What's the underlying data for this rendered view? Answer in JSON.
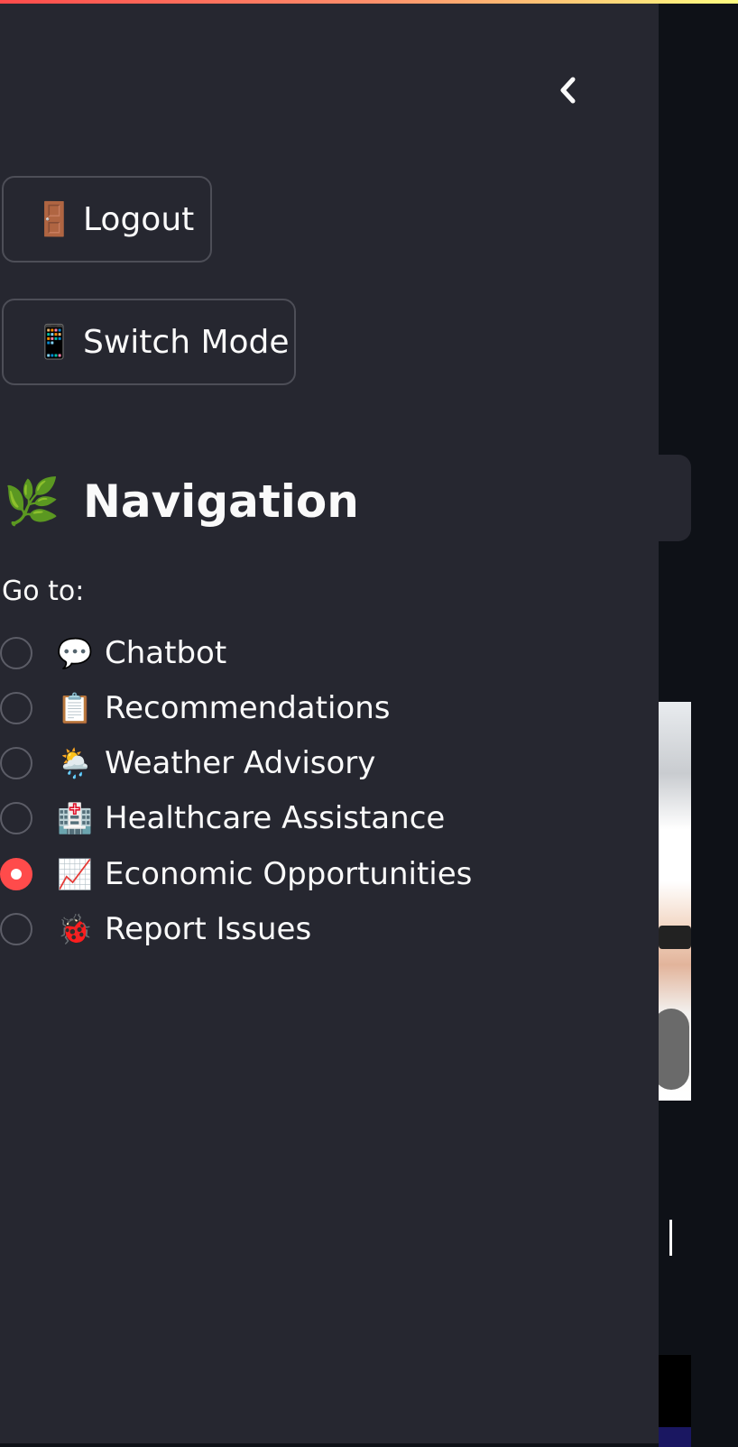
{
  "sidebar": {
    "collapse_icon": "chevron-left-icon",
    "buttons": {
      "logout": {
        "icon": "🚪",
        "label": "Logout"
      },
      "switch_mode": {
        "icon": "📱",
        "label": "Switch Mode"
      }
    },
    "navigation": {
      "heading_icon": "🌿",
      "heading": "Navigation",
      "goto_label": "Go to:",
      "options": [
        {
          "icon": "💬",
          "label": "Chatbot",
          "selected": false
        },
        {
          "icon": "📋",
          "label": "Recommendations",
          "selected": false
        },
        {
          "icon": "🌦️",
          "label": "Weather Advisory",
          "selected": false
        },
        {
          "icon": "🏥",
          "label": "Healthcare Assistance",
          "selected": false
        },
        {
          "icon": "📈",
          "label": "Economic Opportunities",
          "selected": true
        },
        {
          "icon": "🐞",
          "label": "Report Issues",
          "selected": false
        }
      ],
      "selected_value": "Economic Opportunities"
    }
  },
  "theme": {
    "sidebar_bg": "#262730",
    "app_bg": "#0e1117",
    "accent": "#ff4b4b",
    "text": "#fafafa"
  }
}
